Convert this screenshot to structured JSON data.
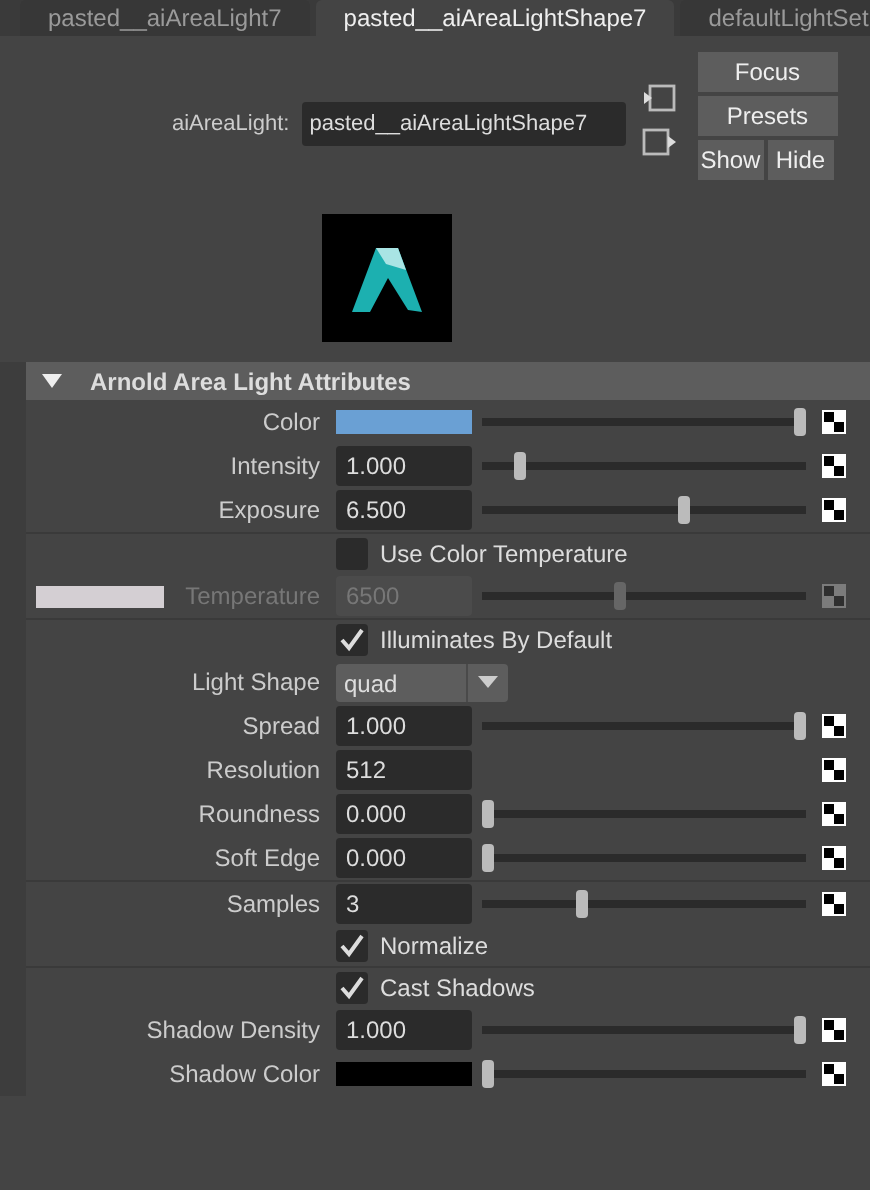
{
  "tabs": [
    {
      "label": "pasted__aiAreaLight7",
      "selected": false
    },
    {
      "label": "pasted__aiAreaLightShape7",
      "selected": true
    },
    {
      "label": "defaultLightSet",
      "selected": false
    }
  ],
  "node": {
    "label": "aiAreaLight:",
    "value": "pasted__aiAreaLightShape7"
  },
  "buttons": [
    {
      "label": "Focus",
      "kind": "wide"
    },
    {
      "label": "Presets",
      "kind": "wide"
    },
    {
      "label": "Show",
      "kind": "half"
    },
    {
      "label": "Hide",
      "kind": "half"
    }
  ],
  "section": {
    "title": "Arnold Area Light Attributes",
    "expanded": true
  },
  "groups": [
    [
      {
        "kind": "color",
        "label": "Color",
        "color": "#6aa0d4",
        "level": 1,
        "map": true
      },
      {
        "kind": "number",
        "label": "Intensity",
        "value": "1.000",
        "level": 0.1,
        "map": true
      },
      {
        "kind": "number",
        "label": "Exposure",
        "value": "6.500",
        "level": 0.63,
        "map": true
      }
    ],
    [
      {
        "kind": "checkbox",
        "label": "Use Color Temperature",
        "checked": false
      },
      {
        "kind": "number",
        "label": "Temperature",
        "value": "6500",
        "level": 0.42,
        "map": true,
        "disabled": true,
        "color": "#d4cfd3"
      }
    ],
    [
      {
        "kind": "checkbox",
        "label": "Illuminates By Default",
        "checked": true
      },
      {
        "kind": "dropdown",
        "label": "Light Shape",
        "value": "quad"
      },
      {
        "kind": "number",
        "label": "Spread",
        "value": "1.000",
        "level": 1,
        "map": true
      },
      {
        "kind": "number",
        "label": "Resolution",
        "value": "512",
        "map": true
      },
      {
        "kind": "number",
        "label": "Roundness",
        "value": "0.000",
        "level": 0,
        "map": true
      },
      {
        "kind": "number",
        "label": "Soft Edge",
        "value": "0.000",
        "level": 0,
        "map": true
      }
    ],
    [
      {
        "kind": "number",
        "label": "Samples",
        "value": "3",
        "level": 0.3,
        "map": true
      },
      {
        "kind": "checkbox",
        "label": "Normalize",
        "checked": true
      }
    ],
    [
      {
        "kind": "checkbox",
        "label": "Cast Shadows",
        "checked": true
      },
      {
        "kind": "number",
        "label": "Shadow Density",
        "value": "1.000",
        "level": 1,
        "map": true
      },
      {
        "kind": "color",
        "label": "Shadow Color",
        "color": "#000000",
        "level": 0,
        "map": true
      }
    ]
  ]
}
